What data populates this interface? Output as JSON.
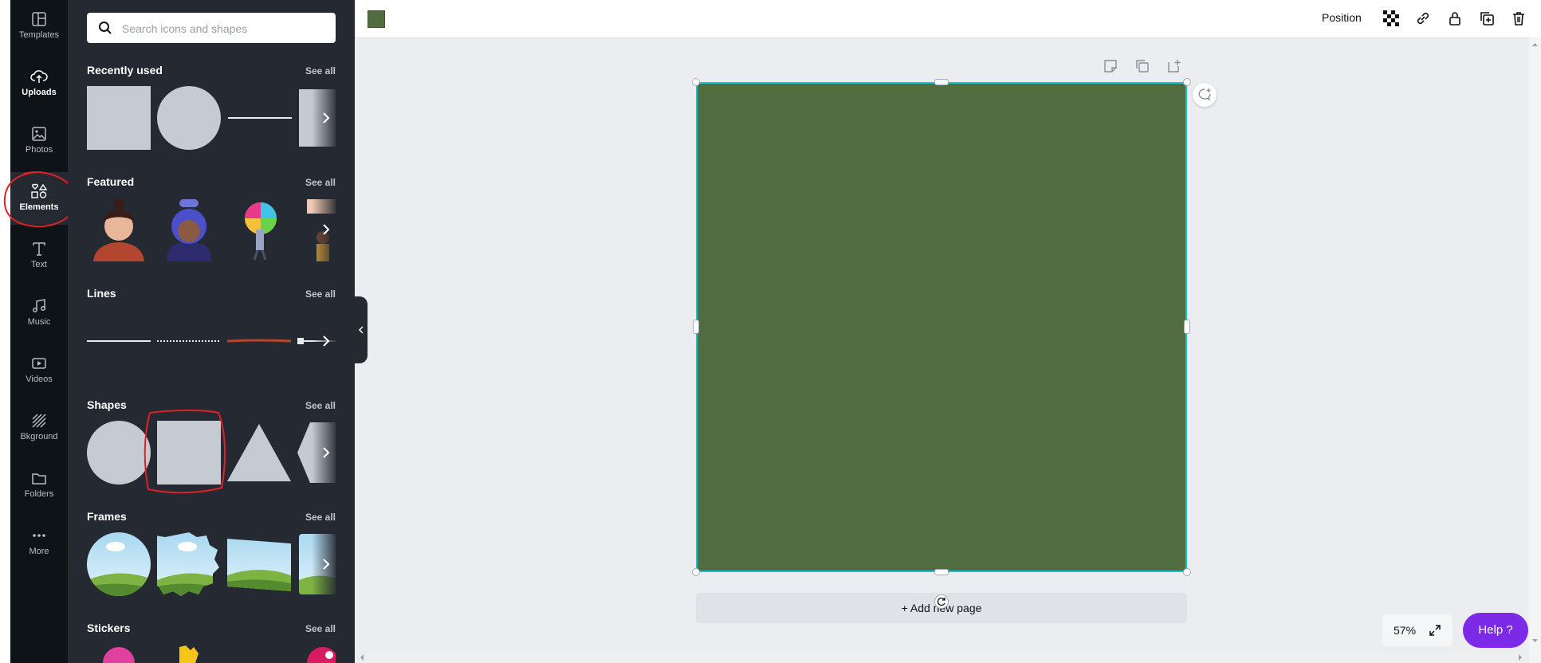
{
  "rail": {
    "items": [
      {
        "label": "Templates",
        "icon": "templates-icon"
      },
      {
        "label": "Uploads",
        "icon": "upload-cloud-icon"
      },
      {
        "label": "Photos",
        "icon": "photo-icon"
      },
      {
        "label": "Elements",
        "icon": "elements-shapes-icon",
        "active": true
      },
      {
        "label": "Text",
        "icon": "text-t-icon"
      },
      {
        "label": "Music",
        "icon": "music-note-icon"
      },
      {
        "label": "Videos",
        "icon": "video-play-icon"
      },
      {
        "label": "Bkground",
        "icon": "background-stripes-icon"
      },
      {
        "label": "Folders",
        "icon": "folder-icon"
      },
      {
        "label": "More",
        "icon": "more-dots-icon"
      }
    ]
  },
  "search": {
    "placeholder": "Search icons and shapes"
  },
  "sections": {
    "recently_used": {
      "title": "Recently used",
      "see_all": "See all"
    },
    "featured": {
      "title": "Featured",
      "see_all": "See all"
    },
    "lines": {
      "title": "Lines",
      "see_all": "See all"
    },
    "shapes": {
      "title": "Shapes",
      "see_all": "See all"
    },
    "frames": {
      "title": "Frames",
      "see_all": "See all"
    },
    "stickers": {
      "title": "Stickers",
      "see_all": "See all"
    }
  },
  "topbar": {
    "position_label": "Position",
    "swatch_color": "#516c3f"
  },
  "canvas": {
    "fill_color": "#516c3f",
    "selection_color": "#13c6cf"
  },
  "add_page_label": "+ Add new page",
  "zoom": {
    "value": "57%"
  },
  "help_label": "Help ?",
  "annotations": {
    "color": "#e0212a"
  }
}
